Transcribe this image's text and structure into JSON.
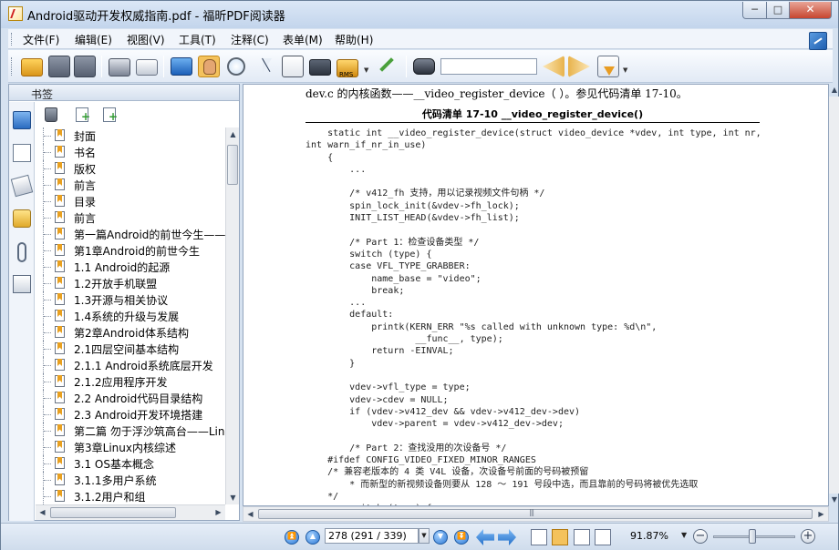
{
  "window": {
    "title": "Android驱动开发权威指南.pdf - 福昕PDF阅读器",
    "minimize_label": "─",
    "maximize_label": "□",
    "close_label": "✕"
  },
  "menu": [
    "文件(F)",
    "编辑(E)",
    "视图(V)",
    "工具(T)",
    "注释(C)",
    "表单(M)",
    "帮助(H)"
  ],
  "toolbar": {
    "search_value": "",
    "rms_label": "RMS",
    "icons": [
      "open-icon",
      "save-icon",
      "save-as-icon",
      "print-icon",
      "email-icon",
      "full-screen-icon",
      "hand-tool-icon",
      "zoom-tool-icon",
      "select-tool-icon",
      "text-select-icon",
      "snapshot-icon",
      "rms-icon",
      "sign-icon",
      "find-icon",
      "previous-result-icon",
      "next-result-icon",
      "sort-icon"
    ]
  },
  "sidebar": {
    "title": "书签",
    "bookmarks": [
      "封面",
      "书名",
      "版权",
      "前言",
      "目录",
      "前言",
      "第一篇Android的前世今生——A",
      "第1章Android的前世今生",
      "1.1  Android的起源",
      "1.2开放手机联盟",
      "1.3开源与相关协议",
      "1.4系统的升级与发展",
      "第2章Android体系结构",
      "2.1四层空间基本结构",
      "2.1.1  Android系统底层开发",
      "2.1.2应用程序开发",
      "2.2  Android代码目录结构",
      "2.3  Android开发环境搭建",
      "第二篇  勿于浮沙筑高台——Lin",
      "第3章Linux内核综述",
      "3.1  OS基本概念",
      "3.1.1多用户系统",
      "3.1.2用户和组"
    ]
  },
  "document": {
    "intro": "dev.c 的内核函数——__video_register_device（ ）。参见代码清单 17-10。",
    "listing_title": "代码清单 17-10    __video_register_device()",
    "code_lines": [
      "    static int __video_register_device(struct video_device *vdev, int type, int nr,",
      "int warn_if_nr_in_use)",
      "    {",
      "        ...",
      "",
      "        /* v412_fh 支持，用以记录视频文件句柄 */",
      "        spin_lock_init(&vdev->fh_lock);",
      "        INIT_LIST_HEAD(&vdev->fh_list);",
      "",
      "        /* Part 1：检查设备类型 */",
      "        switch (type) {",
      "        case VFL_TYPE_GRABBER:",
      "            name_base = \"video\";",
      "            break;",
      "        ...",
      "        default:",
      "            printk(KERN_ERR \"%s called with unknown type: %d\\n\",",
      "                    __func__, type);",
      "            return -EINVAL;",
      "        }",
      "",
      "        vdev->vfl_type = type;",
      "        vdev->cdev = NULL;",
      "        if (vdev->v412_dev && vdev->v412_dev->dev)",
      "            vdev->parent = vdev->v412_dev->dev;",
      "",
      "        /* Part 2：查找没用的次设备号 */",
      "    #ifdef CONFIG_VIDEO_FIXED_MINOR_RANGES",
      "    /* 兼容老版本的 4 类 V4L 设备，次设备号前面的号码被预留",
      "        * 而新型的新视频设备则要从 128 ～ 191 号段中选，而且靠前的号码将被优先选取",
      "    */",
      "        switch (type) {"
    ]
  },
  "status": {
    "page_display": "278 (291 / 339)",
    "zoom": "91.87%",
    "zoom_slider_fraction": 0.45
  },
  "colors": {
    "active_tool": "#f4c25c",
    "accent": "#2c78d4"
  }
}
